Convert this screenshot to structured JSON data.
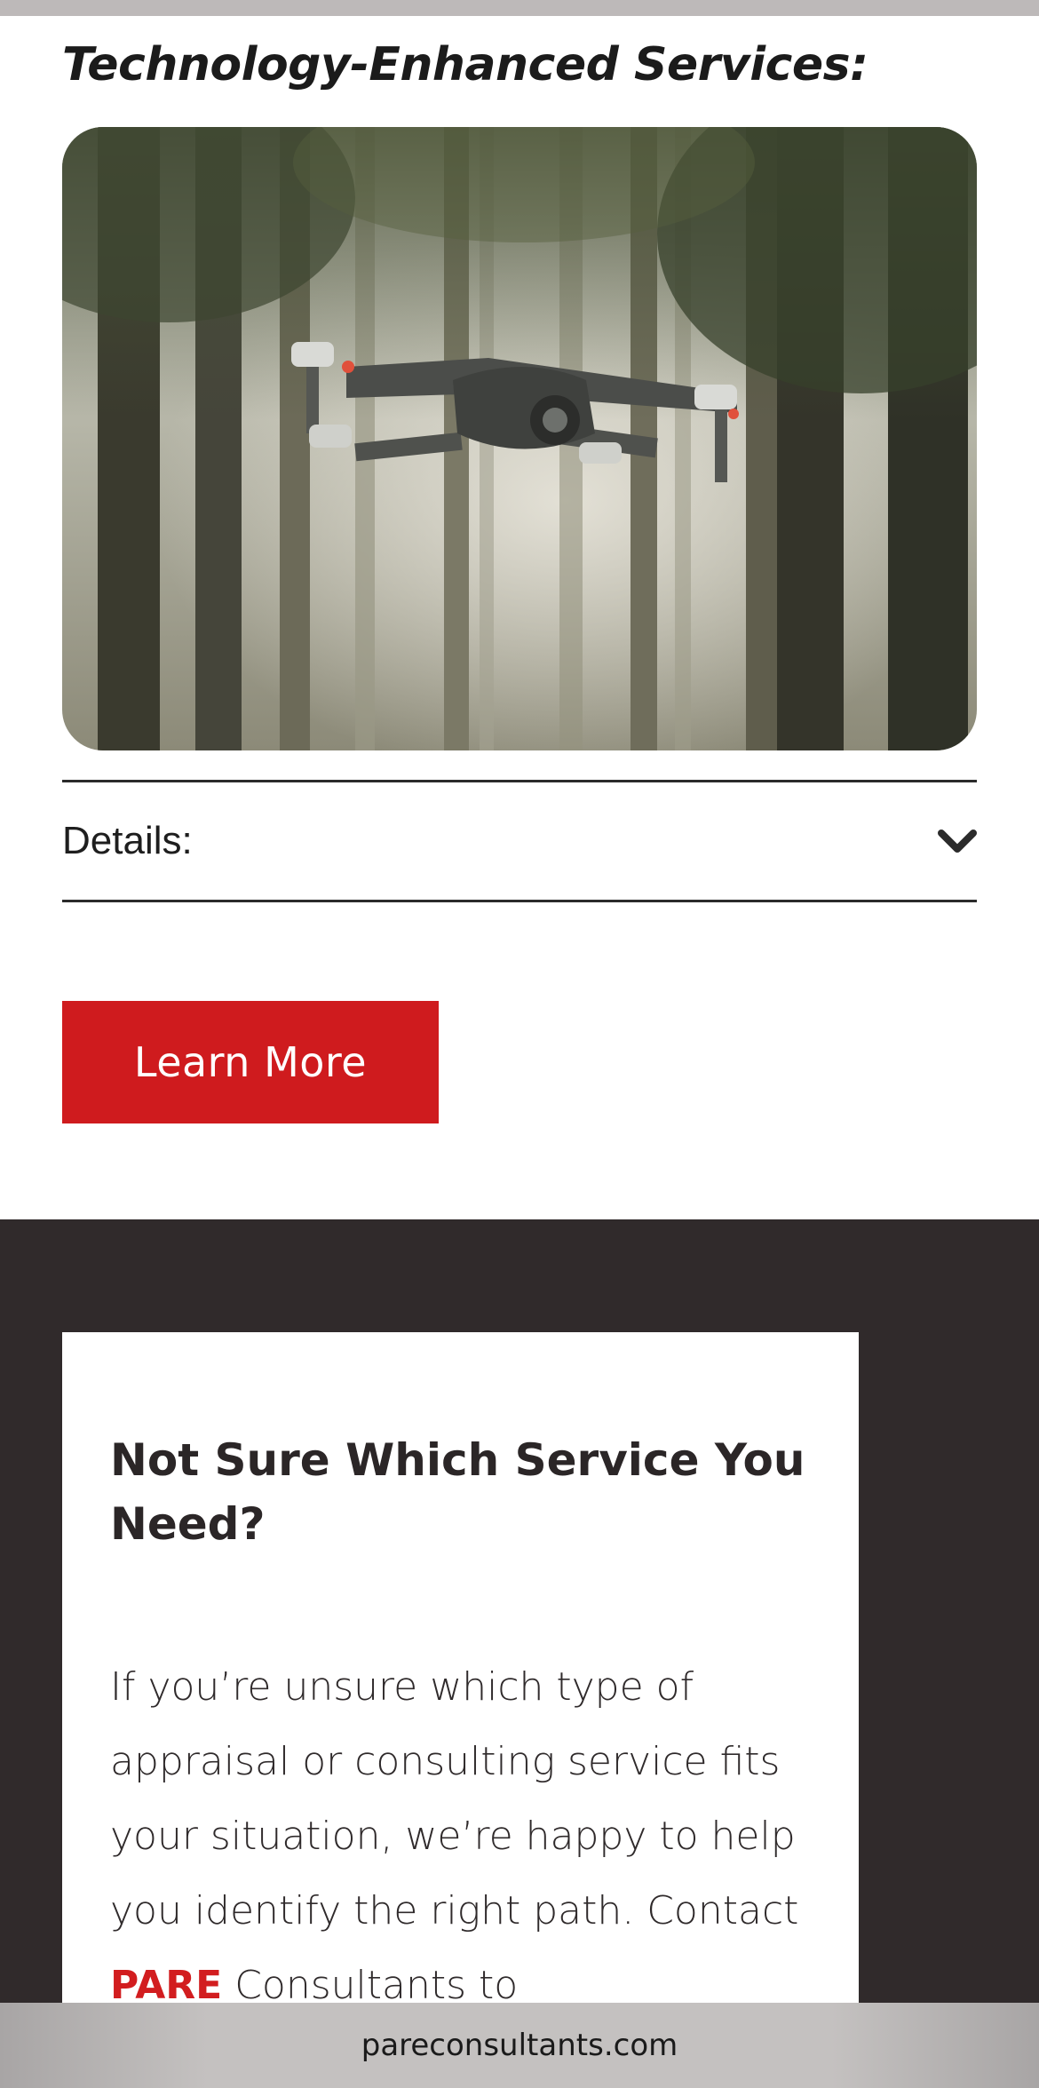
{
  "section": {
    "title": "Technology-Enhanced Services:"
  },
  "hero": {
    "image_description": "drone-over-forest-photo"
  },
  "details": {
    "label": "Details:",
    "icon": "chevron-down-icon"
  },
  "cta": {
    "label": "Learn More",
    "color": "#cf1b1e"
  },
  "help_card": {
    "title": "Not Sure Which Service You Need?",
    "body_part1": "If you’re unsure which type of appraisal or consulting service fits your situation, we’re happy to help you identify the right path. Contact ",
    "brand": "PARE",
    "body_part2": " Consultants to"
  },
  "browser": {
    "url": "pareconsultants.com"
  },
  "colors": {
    "accent": "#cf1b1e",
    "dark_section": "#302a2b",
    "text": "#2b2627"
  }
}
